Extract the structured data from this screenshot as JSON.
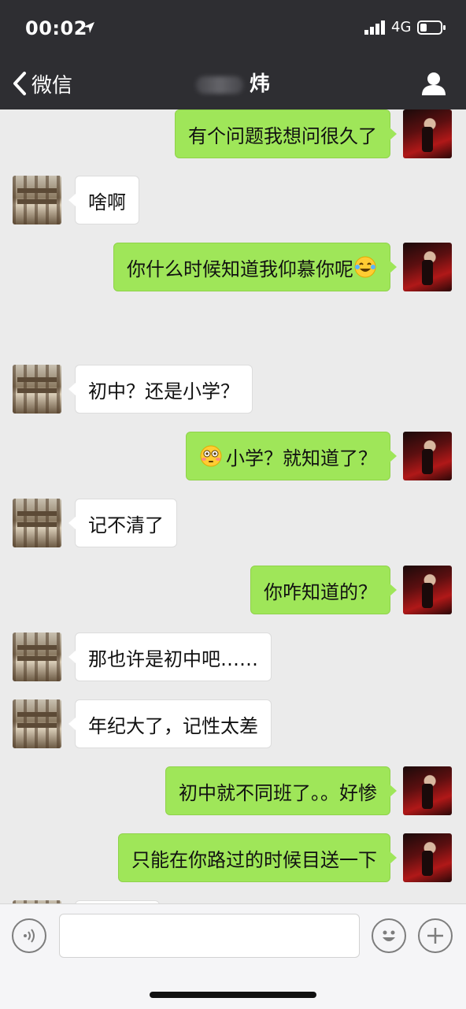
{
  "status_bar": {
    "time": "00:02",
    "network": "4G"
  },
  "nav": {
    "back_label": "微信",
    "title": "炜"
  },
  "messages": [
    {
      "side": "me",
      "text": "有个问题我想问很久了"
    },
    {
      "side": "other",
      "text": "啥啊"
    },
    {
      "side": "me",
      "text": "你什么时候知道我仰慕你呢",
      "emoji_after": "laughing-tears-emoji"
    },
    {
      "side": "other",
      "text": "初中？还是小学？"
    },
    {
      "side": "me",
      "text": "小学？就知道了？",
      "emoji_before": "flushed-emoji"
    },
    {
      "side": "other",
      "text": "记不清了"
    },
    {
      "side": "me",
      "text": "你咋知道的？"
    },
    {
      "side": "other",
      "text": "那也许是初中吧……"
    },
    {
      "side": "other",
      "text": "年纪大了，记性太差"
    },
    {
      "side": "me",
      "text": "初中就不同班了。。好惨"
    },
    {
      "side": "me",
      "text": "只能在你路过的时候目送一下"
    }
  ],
  "input": {
    "placeholder": ""
  },
  "colors": {
    "nav_bg": "#2e2e32",
    "chat_bg": "#ebebeb",
    "my_bubble": "#9fe659",
    "their_bubble": "#ffffff"
  }
}
